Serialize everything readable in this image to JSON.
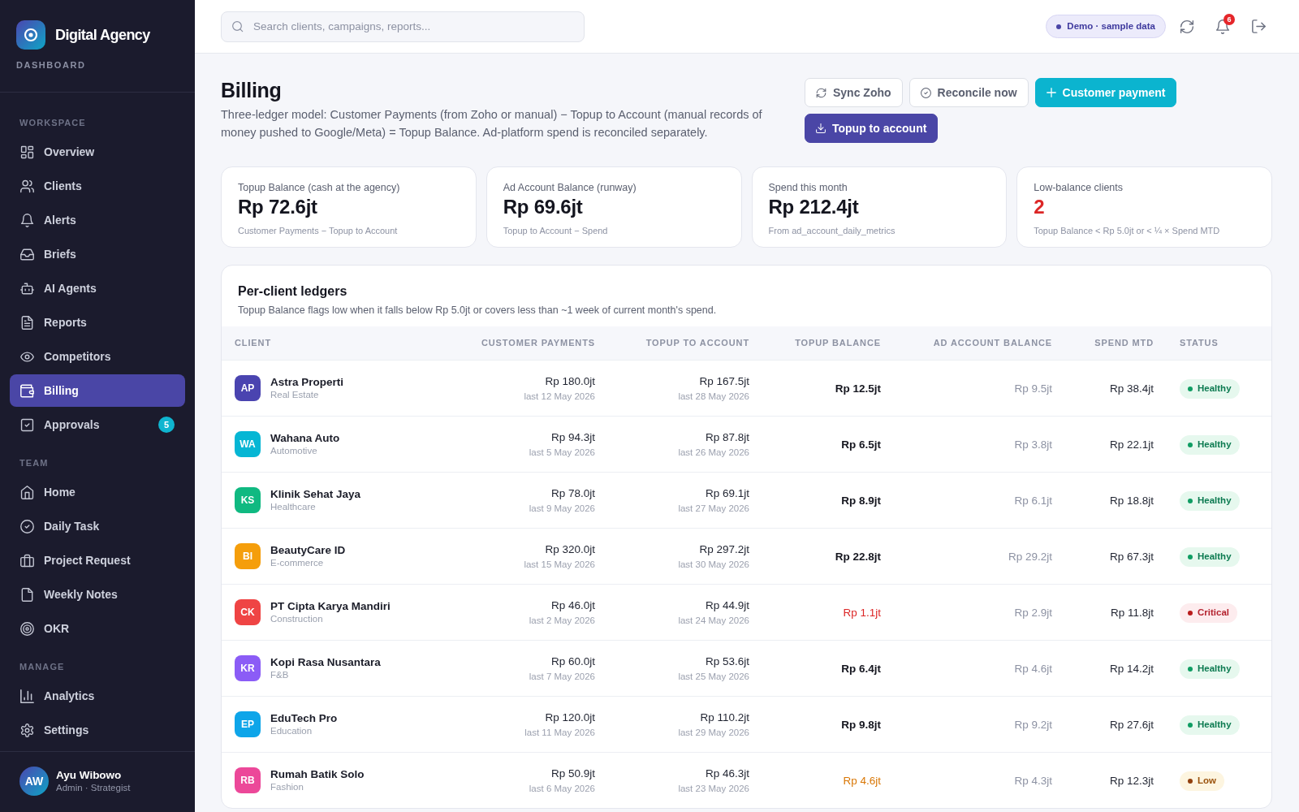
{
  "sidebar": {
    "brand": {
      "name": "Digital Agency",
      "subtitle": "DASHBOARD"
    },
    "sections": [
      {
        "title": "WORKSPACE",
        "items": [
          {
            "label": "Overview",
            "selected": false
          },
          {
            "label": "Clients",
            "selected": false
          },
          {
            "label": "Alerts",
            "selected": false
          },
          {
            "label": "Briefs",
            "selected": false
          },
          {
            "label": "AI Agents",
            "selected": false
          },
          {
            "label": "Reports",
            "selected": false
          },
          {
            "label": "Competitors",
            "selected": false
          },
          {
            "label": "Billing",
            "selected": true
          },
          {
            "label": "Approvals",
            "selected": false,
            "badge": "5"
          }
        ]
      },
      {
        "title": "TEAM",
        "items": [
          {
            "label": "Home",
            "selected": false
          },
          {
            "label": "Daily Task",
            "selected": false
          },
          {
            "label": "Project Request",
            "selected": false
          },
          {
            "label": "Weekly Notes",
            "selected": false
          },
          {
            "label": "OKR",
            "selected": false
          }
        ]
      },
      {
        "title": "MANAGE",
        "items": [
          {
            "label": "Analytics",
            "selected": false
          },
          {
            "label": "Settings",
            "selected": false
          }
        ]
      }
    ],
    "user": {
      "initials": "AW",
      "name": "Ayu Wibowo",
      "role": "Admin · Strategist"
    }
  },
  "topbar": {
    "search": {
      "placeholder": "Search clients, campaigns, reports..."
    },
    "mode_badge": "Demo · sample data",
    "notifications": "6"
  },
  "page": {
    "title": "Billing",
    "description": "Three-ledger model: Customer Payments (from Zoho or manual) − Topup to Account (manual records of money pushed to Google/Meta) = Topup Balance. Ad-platform spend is reconciled separately.",
    "actions": [
      {
        "label": "Sync Zoho",
        "kind": "outline"
      },
      {
        "label": "Reconcile now",
        "kind": "outline"
      },
      {
        "label": "Customer payment",
        "kind": "accent"
      },
      {
        "label": "Topup to account",
        "kind": "primary"
      }
    ]
  },
  "stats": [
    {
      "label": "Topup Balance (cash at the agency)",
      "value": "Rp 72.6jt",
      "note": "Customer Payments − Topup to Account",
      "kind": "plain"
    },
    {
      "label": "Ad Account Balance (runway)",
      "value": "Rp 69.6jt",
      "note": "Topup to Account − Spend",
      "kind": "plain"
    },
    {
      "label": "Spend this month",
      "value": "Rp 212.4jt",
      "note": "From ad_account_daily_metrics",
      "kind": "plain"
    },
    {
      "label": "Low-balance clients",
      "value": "2",
      "note": "Topup Balance < Rp 5.0jt or < ¼ × Spend MTD",
      "kind": "alert"
    }
  ],
  "ledger": {
    "title": "Per-client ledgers",
    "subtitle": "Topup Balance flags low when it falls below Rp 5.0jt or covers less than ~1 week of current month's spend.",
    "columns": [
      "CLIENT",
      "CUSTOMER PAYMENTS",
      "TOPUP TO ACCOUNT",
      "TOPUP BALANCE",
      "AD ACCOUNT BALANCE",
      "SPEND MTD",
      "STATUS"
    ],
    "rows": [
      {
        "client": {
          "initials": "AP",
          "name": "Astra Properti",
          "category": "Real Estate",
          "color": "#4a44b0"
        },
        "customer_payments": {
          "amount": "Rp 180.0jt",
          "last": "last 12 May 2026"
        },
        "topup_to_account": {
          "amount": "Rp 167.5jt",
          "last": "last 28 May 2026"
        },
        "topup_balance": "Rp 12.5jt",
        "ad_account_balance": "Rp 9.5jt",
        "spend_mtd": "Rp 38.4jt",
        "status": {
          "label": "Healthy",
          "kind": "healthy"
        }
      },
      {
        "client": {
          "initials": "WA",
          "name": "Wahana Auto",
          "category": "Automotive",
          "color": "#06b6d4"
        },
        "customer_payments": {
          "amount": "Rp 94.3jt",
          "last": "last 5 May 2026"
        },
        "topup_to_account": {
          "amount": "Rp 87.8jt",
          "last": "last 26 May 2026"
        },
        "topup_balance": "Rp 6.5jt",
        "ad_account_balance": "Rp 3.8jt",
        "spend_mtd": "Rp 22.1jt",
        "status": {
          "label": "Healthy",
          "kind": "healthy"
        }
      },
      {
        "client": {
          "initials": "KS",
          "name": "Klinik Sehat Jaya",
          "category": "Healthcare",
          "color": "#10b981"
        },
        "customer_payments": {
          "amount": "Rp 78.0jt",
          "last": "last 9 May 2026"
        },
        "topup_to_account": {
          "amount": "Rp 69.1jt",
          "last": "last 27 May 2026"
        },
        "topup_balance": "Rp 8.9jt",
        "ad_account_balance": "Rp 6.1jt",
        "spend_mtd": "Rp 18.8jt",
        "status": {
          "label": "Healthy",
          "kind": "healthy"
        }
      },
      {
        "client": {
          "initials": "BI",
          "name": "BeautyCare ID",
          "category": "E-commerce",
          "color": "#f59e0b"
        },
        "customer_payments": {
          "amount": "Rp 320.0jt",
          "last": "last 15 May 2026"
        },
        "topup_to_account": {
          "amount": "Rp 297.2jt",
          "last": "last 30 May 2026"
        },
        "topup_balance": "Rp 22.8jt",
        "ad_account_balance": "Rp 29.2jt",
        "spend_mtd": "Rp 67.3jt",
        "status": {
          "label": "Healthy",
          "kind": "healthy"
        }
      },
      {
        "client": {
          "initials": "CK",
          "name": "PT Cipta Karya Mandiri",
          "category": "Construction",
          "color": "#ef4444"
        },
        "customer_payments": {
          "amount": "Rp 46.0jt",
          "last": "last 2 May 2026"
        },
        "topup_to_account": {
          "amount": "Rp 44.9jt",
          "last": "last 24 May 2026"
        },
        "topup_balance": "Rp 1.1jt",
        "ad_account_balance": "Rp 2.9jt",
        "spend_mtd": "Rp 11.8jt",
        "status": {
          "label": "Critical",
          "kind": "critical"
        }
      },
      {
        "client": {
          "initials": "KR",
          "name": "Kopi Rasa Nusantara",
          "category": "F&B",
          "color": "#8b5cf6"
        },
        "customer_payments": {
          "amount": "Rp 60.0jt",
          "last": "last 7 May 2026"
        },
        "topup_to_account": {
          "amount": "Rp 53.6jt",
          "last": "last 25 May 2026"
        },
        "topup_balance": "Rp 6.4jt",
        "ad_account_balance": "Rp 4.6jt",
        "spend_mtd": "Rp 14.2jt",
        "status": {
          "label": "Healthy",
          "kind": "healthy"
        }
      },
      {
        "client": {
          "initials": "EP",
          "name": "EduTech Pro",
          "category": "Education",
          "color": "#0ea5e9"
        },
        "customer_payments": {
          "amount": "Rp 120.0jt",
          "last": "last 11 May 2026"
        },
        "topup_to_account": {
          "amount": "Rp 110.2jt",
          "last": "last 29 May 2026"
        },
        "topup_balance": "Rp 9.8jt",
        "ad_account_balance": "Rp 9.2jt",
        "spend_mtd": "Rp 27.6jt",
        "status": {
          "label": "Healthy",
          "kind": "healthy"
        }
      },
      {
        "client": {
          "initials": "RB",
          "name": "Rumah Batik Solo",
          "category": "Fashion",
          "color": "#ec4899"
        },
        "customer_payments": {
          "amount": "Rp 50.9jt",
          "last": "last 6 May 2026"
        },
        "topup_to_account": {
          "amount": "Rp 46.3jt",
          "last": "last 23 May 2026"
        },
        "topup_balance": "Rp 4.6jt",
        "ad_account_balance": "Rp 4.3jt",
        "spend_mtd": "Rp 12.3jt",
        "status": {
          "label": "Low",
          "kind": "low"
        }
      }
    ]
  }
}
